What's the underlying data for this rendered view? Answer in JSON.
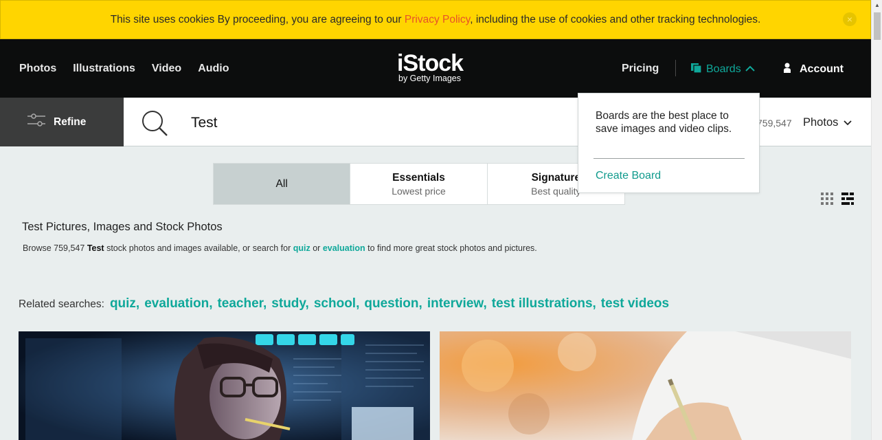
{
  "cookie": {
    "text_before": "This site uses cookies By proceeding, you are agreeing to our ",
    "link": "Privacy Policy",
    "text_after": ", including the use of cookies and other tracking technologies.",
    "close": "×"
  },
  "nav": {
    "left": [
      "Photos",
      "Illustrations",
      "Video",
      "Audio"
    ],
    "logo_main": "iStock",
    "logo_sub": "by Getty Images",
    "pricing": "Pricing",
    "boards": "Boards",
    "account": "Account"
  },
  "search": {
    "refine": "Refine",
    "query": "Test",
    "count": "759,547",
    "type": "Photos"
  },
  "tabs": [
    {
      "title": "All",
      "subtitle": ""
    },
    {
      "title": "Essentials",
      "subtitle": "Lowest price"
    },
    {
      "title": "Signature",
      "subtitle": "Best quality"
    }
  ],
  "boards_popup": {
    "message": "Boards are the best place to save images and video clips.",
    "create": "Create Board"
  },
  "page": {
    "title": "Test Pictures, Images and Stock Photos",
    "browse_1": "Browse 759,547 ",
    "browse_term": "Test",
    "browse_2": " stock photos and images available, or search for ",
    "browse_link1": "quiz",
    "browse_or": " or ",
    "browse_link2": "evaluation",
    "browse_3": " to find more great stock photos and pictures."
  },
  "related": {
    "label": "Related searches:",
    "items": [
      "quiz,",
      "evaluation,",
      "teacher,",
      "study,",
      "school,",
      "question,",
      "interview,",
      "test illustrations,",
      "test videos"
    ]
  },
  "colors": {
    "accent": "#0fa89a",
    "banner": "#ffd500",
    "header": "#0c0d0d",
    "privacy_link": "#e8512a"
  }
}
